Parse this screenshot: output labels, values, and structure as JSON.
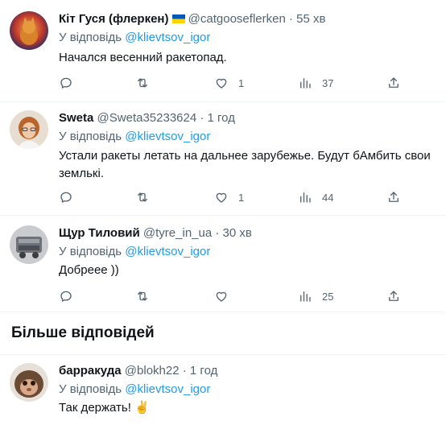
{
  "tweets": [
    {
      "name": "Кіт Гуся (флеркен)",
      "handle": "@catgooseflerken",
      "dot": "·",
      "time": "55 хв",
      "reply_prefix": "У відповідь",
      "reply_to": "@klievtsov_igor",
      "text": "Начался весенний ракетопад.",
      "likes": "1",
      "views": "37",
      "flag_colors": [
        "#0057b7",
        "#ffd700"
      ]
    },
    {
      "name": "Sweta",
      "handle": "@Sweta35233624",
      "dot": "·",
      "time": "1 год",
      "reply_prefix": "У відповідь",
      "reply_to": "@klievtsov_igor",
      "text": "Устали ракеты летать на дальнее зарубежье. Будут бАмбить свои землькі.",
      "likes": "1",
      "views": "44"
    },
    {
      "name": "Щур Тиловий",
      "handle": "@tyre_in_ua",
      "dot": "·",
      "time": "30 хв",
      "reply_prefix": "У відповідь",
      "reply_to": "@klievtsov_igor",
      "text": "Добреее ))",
      "likes": "",
      "views": "25"
    },
    {
      "name": "барракуда",
      "handle": "@blokh22",
      "dot": "·",
      "time": "1 год",
      "reply_prefix": "У відповідь",
      "reply_to": "@klievtsov_igor",
      "text": "Так держать! ✌️"
    }
  ],
  "section_title": "Більше відповідей",
  "icons": [
    "reply-icon",
    "retweet-icon",
    "like-icon",
    "views-icon",
    "share-icon"
  ],
  "colors": {
    "mention": "#1d9bf0",
    "muted": "#536471",
    "text": "#0f1419"
  }
}
